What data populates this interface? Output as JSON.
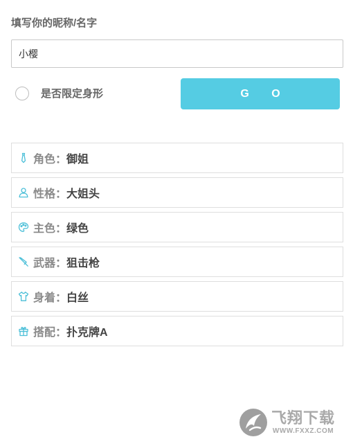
{
  "form": {
    "prompt_label": "填写你的昵称/名字",
    "name_value": "小樱",
    "restrict_label": "是否限定身形",
    "restrict_checked": false,
    "go_label": "G O"
  },
  "results": [
    {
      "icon": "tie-icon",
      "label": "角色：",
      "value": "御姐"
    },
    {
      "icon": "person-icon",
      "label": "性格：",
      "value": "大姐头"
    },
    {
      "icon": "palette-icon",
      "label": "主色：",
      "value": "绿色"
    },
    {
      "icon": "knife-icon",
      "label": "武器：",
      "value": "狙击枪"
    },
    {
      "icon": "shirt-icon",
      "label": "身着：",
      "value": "白丝"
    },
    {
      "icon": "gift-icon",
      "label": "搭配：",
      "value": "扑克牌A"
    }
  ],
  "colors": {
    "accent": "#55cce3",
    "icon": "#4bbfd8",
    "label": "#8a8a8a",
    "value": "#444444",
    "border": "#dedede"
  },
  "watermark": {
    "title": "飞翔下载",
    "url": "WWW.FXXZ.COM",
    "logo_icon": "fxxz-logo-icon"
  }
}
